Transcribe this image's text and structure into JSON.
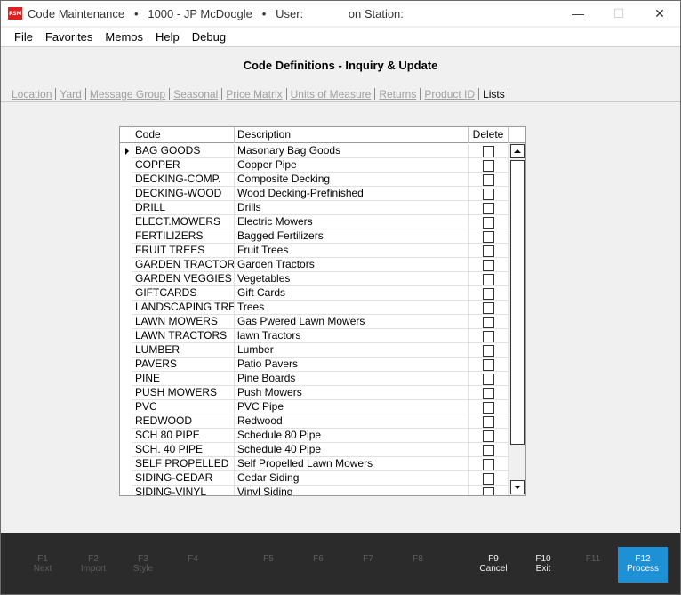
{
  "window": {
    "logo_text": "RSM",
    "title": "Code Maintenance   •   1000 - JP McDoogle   •   User:              on Station:",
    "minimize": "—",
    "maximize": "☐",
    "close": "✕"
  },
  "menu": [
    "File",
    "Favorites",
    "Memos",
    "Help",
    "Debug"
  ],
  "header": {
    "title": "Code Definitions - Inquiry & Update"
  },
  "tabs": [
    {
      "label": "Location",
      "active": false
    },
    {
      "label": "Yard",
      "active": false
    },
    {
      "label": "Message Group",
      "active": false
    },
    {
      "label": "Seasonal",
      "active": false
    },
    {
      "label": "Price Matrix",
      "active": false
    },
    {
      "label": "Units of Measure",
      "active": false
    },
    {
      "label": "Returns",
      "active": false
    },
    {
      "label": "Product ID",
      "active": false
    },
    {
      "label": "Lists",
      "active": true
    }
  ],
  "grid": {
    "columns": {
      "code": "Code",
      "description": "Description",
      "delete": "Delete"
    },
    "rows": [
      {
        "code": "BAG GOODS",
        "description": "Masonary Bag Goods",
        "delete": false
      },
      {
        "code": "COPPER",
        "description": "Copper Pipe",
        "delete": false
      },
      {
        "code": "DECKING-COMP.",
        "description": "Composite Decking",
        "delete": false
      },
      {
        "code": "DECKING-WOOD",
        "description": "Wood Decking-Prefinished",
        "delete": false
      },
      {
        "code": "DRILL",
        "description": "Drills",
        "delete": false
      },
      {
        "code": "ELECT.MOWERS",
        "description": "Electric Mowers",
        "delete": false
      },
      {
        "code": "FERTILIZERS",
        "description": "Bagged Fertilizers",
        "delete": false
      },
      {
        "code": "FRUIT TREES",
        "description": "Fruit Trees",
        "delete": false
      },
      {
        "code": "GARDEN TRACTOR",
        "description": "Garden Tractors",
        "delete": false
      },
      {
        "code": "GARDEN VEGGIES",
        "description": "Vegetables",
        "delete": false
      },
      {
        "code": "GIFTCARDS",
        "description": "Gift Cards",
        "delete": false
      },
      {
        "code": "LANDSCAPING TRE",
        "description": "Trees",
        "delete": false
      },
      {
        "code": "LAWN MOWERS",
        "description": "Gas Pwered Lawn Mowers",
        "delete": false
      },
      {
        "code": "LAWN TRACTORS",
        "description": "lawn Tractors",
        "delete": false
      },
      {
        "code": "LUMBER",
        "description": "Lumber",
        "delete": false
      },
      {
        "code": "PAVERS",
        "description": "Patio Pavers",
        "delete": false
      },
      {
        "code": "PINE",
        "description": "Pine Boards",
        "delete": false
      },
      {
        "code": "PUSH MOWERS",
        "description": "Push Mowers",
        "delete": false
      },
      {
        "code": "PVC",
        "description": "PVC Pipe",
        "delete": false
      },
      {
        "code": "REDWOOD",
        "description": "Redwood",
        "delete": false
      },
      {
        "code": "SCH 80 PIPE",
        "description": "Schedule 80 Pipe",
        "delete": false
      },
      {
        "code": "SCH. 40 PIPE",
        "description": "Schedule 40 Pipe",
        "delete": false
      },
      {
        "code": "SELF PROPELLED",
        "description": "Self Propelled Lawn Mowers",
        "delete": false
      },
      {
        "code": "SIDING-CEDAR",
        "description": "Cedar Siding",
        "delete": false
      },
      {
        "code": "SIDING-VINYL",
        "description": "Vinyl Siding",
        "delete": false
      }
    ],
    "selected_row": 0
  },
  "function_keys": [
    {
      "key": "F1",
      "label": "Next",
      "enabled": false
    },
    {
      "key": "F2",
      "label": "Import",
      "enabled": false
    },
    {
      "key": "F3",
      "label": "Style",
      "enabled": false
    },
    {
      "key": "F4",
      "label": "",
      "enabled": false
    },
    {
      "key": "F5",
      "label": "",
      "enabled": false
    },
    {
      "key": "F6",
      "label": "",
      "enabled": false
    },
    {
      "key": "F7",
      "label": "",
      "enabled": false
    },
    {
      "key": "F8",
      "label": "",
      "enabled": false
    },
    {
      "key": "F9",
      "label": "Cancel",
      "enabled": true
    },
    {
      "key": "F10",
      "label": "Exit",
      "enabled": true
    },
    {
      "key": "F11",
      "label": "",
      "enabled": false
    },
    {
      "key": "F12",
      "label": "Process",
      "enabled": true,
      "primary": true
    }
  ],
  "colors": {
    "primary_key": "#1e90d6",
    "fkey_bar": "#2b2b2b",
    "logo": "#e02020"
  }
}
